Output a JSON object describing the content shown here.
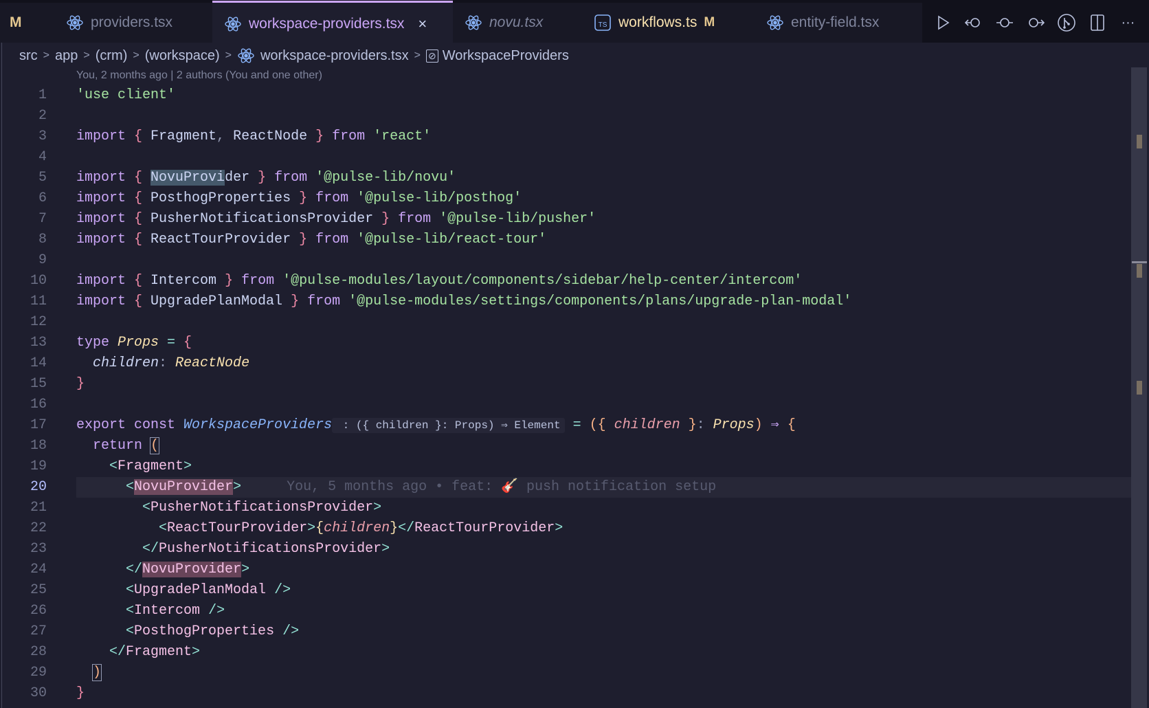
{
  "tabs": [
    {
      "label": "M",
      "kind": "modified-marker"
    },
    {
      "label": "providers.tsx",
      "icon": "react-icon"
    },
    {
      "label": "workspace-providers.tsx",
      "icon": "react-icon",
      "active": true,
      "close": "×"
    },
    {
      "label": "novu.tsx",
      "icon": "react-icon",
      "preview": true
    },
    {
      "label": "workflows.ts",
      "icon": "typescript-icon",
      "modified": "M"
    },
    {
      "label": "entity-field.tsx",
      "icon": "react-icon"
    }
  ],
  "actions": [
    "run-icon",
    "go-back-icon",
    "commit-icon",
    "go-forward-icon",
    "source-control-icon",
    "split-editor-icon",
    "more-icon"
  ],
  "breadcrumbs": [
    "src",
    "app",
    "(crm)",
    "(workspace)",
    "workspace-providers.tsx",
    "WorkspaceProviders"
  ],
  "blame_header": "You, 2 months ago | 2 authors (You and one other)",
  "current_line": 20,
  "colors": {
    "bg": "#1e1e2e",
    "accent": "#cba6f7"
  },
  "code": [
    [
      [
        "str",
        "'use client'"
      ]
    ],
    [],
    [
      [
        "kw",
        "import "
      ],
      [
        "br",
        "{ "
      ],
      [
        "id",
        "Fragment"
      ],
      [
        "pn",
        ", "
      ],
      [
        "id",
        "ReactNode "
      ],
      [
        "br",
        "} "
      ],
      [
        "kw",
        "from "
      ],
      [
        "str",
        "'react'"
      ]
    ],
    [],
    [
      [
        "kw",
        "import "
      ],
      [
        "br",
        "{ "
      ],
      [
        "hl",
        "NovuProvi"
      ],
      [
        "id",
        "der "
      ],
      [
        "br",
        "} "
      ],
      [
        "kw",
        "from "
      ],
      [
        "str",
        "'@pulse-lib/novu'"
      ]
    ],
    [
      [
        "kw",
        "import "
      ],
      [
        "br",
        "{ "
      ],
      [
        "id",
        "PosthogProperties "
      ],
      [
        "br",
        "} "
      ],
      [
        "kw",
        "from "
      ],
      [
        "str",
        "'@pulse-lib/posthog'"
      ]
    ],
    [
      [
        "kw",
        "import "
      ],
      [
        "br",
        "{ "
      ],
      [
        "id",
        "PusherNotificationsProvider "
      ],
      [
        "br",
        "} "
      ],
      [
        "kw",
        "from "
      ],
      [
        "str",
        "'@pulse-lib/pusher'"
      ]
    ],
    [
      [
        "kw",
        "import "
      ],
      [
        "br",
        "{ "
      ],
      [
        "id",
        "ReactTourProvider "
      ],
      [
        "br",
        "} "
      ],
      [
        "kw",
        "from "
      ],
      [
        "str",
        "'@pulse-lib/react-tour'"
      ]
    ],
    [],
    [
      [
        "kw",
        "import "
      ],
      [
        "br",
        "{ "
      ],
      [
        "id",
        "Intercom "
      ],
      [
        "br",
        "} "
      ],
      [
        "kw",
        "from "
      ],
      [
        "str",
        "'@pulse-modules/layout/components/sidebar/help-center/intercom'"
      ]
    ],
    [
      [
        "kw",
        "import "
      ],
      [
        "br",
        "{ "
      ],
      [
        "id",
        "UpgradePlanModal "
      ],
      [
        "br",
        "} "
      ],
      [
        "kw",
        "from "
      ],
      [
        "str",
        "'@pulse-modules/settings/components/plans/upgrade-plan-modal'"
      ]
    ],
    [],
    [
      [
        "kw",
        "type "
      ],
      [
        "ty",
        "Props"
      ],
      [
        "op",
        " = "
      ],
      [
        "br",
        "{"
      ]
    ],
    [
      [
        "id",
        "  "
      ],
      [
        "pr",
        "children"
      ],
      [
        "pn",
        ": "
      ],
      [
        "ty",
        "ReactNode"
      ]
    ],
    [
      [
        "br",
        "}"
      ]
    ],
    [],
    [
      [
        "kw",
        "export const "
      ],
      [
        "fn",
        "WorkspaceProviders"
      ],
      [
        "hint",
        " : ({ children }: Props) ⇒ Element"
      ],
      [
        "op",
        " = "
      ],
      [
        "pa",
        "({ "
      ],
      [
        "par",
        "children"
      ],
      [
        "pa",
        " }"
      ],
      [
        "pn",
        ": "
      ],
      [
        "ty",
        "Props"
      ],
      [
        "pa",
        ")"
      ],
      [
        "kw",
        " ⇒ "
      ],
      [
        "pa",
        "{"
      ]
    ],
    [
      [
        "kw",
        "  return "
      ],
      [
        "bxpa",
        "("
      ]
    ],
    [
      [
        "id",
        "    "
      ],
      [
        "tg",
        "<"
      ],
      [
        "tn",
        "Fragment"
      ],
      [
        "tg",
        ">"
      ]
    ],
    [
      [
        "id",
        "      "
      ],
      [
        "tg",
        "<"
      ],
      [
        "hlrtn",
        "NovuProvider"
      ],
      [
        "tg",
        ">"
      ],
      [
        "ghost",
        "You, 5 months ago • feat: 🎸 push notification setup"
      ]
    ],
    [
      [
        "id",
        "        "
      ],
      [
        "tg",
        "<"
      ],
      [
        "tn",
        "PusherNotificationsProvider"
      ],
      [
        "tg",
        ">"
      ]
    ],
    [
      [
        "id",
        "          "
      ],
      [
        "tg",
        "<"
      ],
      [
        "tn",
        "ReactTourProvider"
      ],
      [
        "tg",
        ">"
      ],
      [
        "yb",
        "{"
      ],
      [
        "par",
        "children"
      ],
      [
        "yb",
        "}"
      ],
      [
        "tg",
        "</"
      ],
      [
        "tn",
        "ReactTourProvider"
      ],
      [
        "tg",
        ">"
      ]
    ],
    [
      [
        "id",
        "        "
      ],
      [
        "tg",
        "</"
      ],
      [
        "tn",
        "PusherNotificationsProvider"
      ],
      [
        "tg",
        ">"
      ]
    ],
    [
      [
        "id",
        "      "
      ],
      [
        "tg",
        "</"
      ],
      [
        "hlrtn",
        "NovuProvider"
      ],
      [
        "tg",
        ">"
      ]
    ],
    [
      [
        "id",
        "      "
      ],
      [
        "tg",
        "<"
      ],
      [
        "tn",
        "UpgradePlanModal "
      ],
      [
        "tg",
        "/>"
      ]
    ],
    [
      [
        "id",
        "      "
      ],
      [
        "tg",
        "<"
      ],
      [
        "tn",
        "Intercom "
      ],
      [
        "tg",
        "/>"
      ]
    ],
    [
      [
        "id",
        "      "
      ],
      [
        "tg",
        "<"
      ],
      [
        "tn",
        "PosthogProperties "
      ],
      [
        "tg",
        "/>"
      ]
    ],
    [
      [
        "id",
        "    "
      ],
      [
        "tg",
        "</"
      ],
      [
        "tn",
        "Fragment"
      ],
      [
        "tg",
        ">"
      ]
    ],
    [
      [
        "id",
        "  "
      ],
      [
        "bxpa",
        ")"
      ]
    ],
    [
      [
        "br",
        "}"
      ]
    ]
  ]
}
